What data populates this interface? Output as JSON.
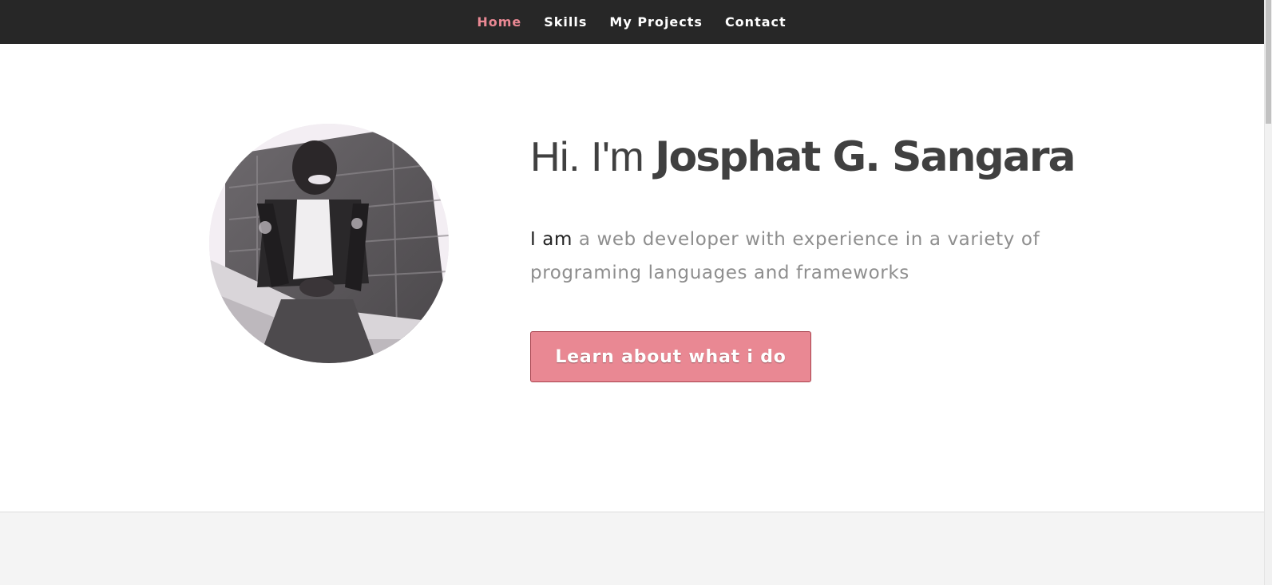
{
  "nav": {
    "items": [
      {
        "label": "Home",
        "active": true
      },
      {
        "label": "Skills",
        "active": false
      },
      {
        "label": "My Projects",
        "active": false
      },
      {
        "label": "Contact",
        "active": false
      }
    ]
  },
  "hero": {
    "greeting_prefix": "Hi. I'm ",
    "name": "Josphat G. Sangara",
    "tagline_lead": "I am",
    "tagline_rest": " a web developer with experience in a variety of programing languages and frameworks",
    "cta_label": "Learn about what i do",
    "avatar_alt": "profile photo"
  },
  "colors": {
    "accent": "#e98893",
    "nav_background": "#272727",
    "heading": "#404040",
    "muted_text": "#8e8e8e"
  }
}
